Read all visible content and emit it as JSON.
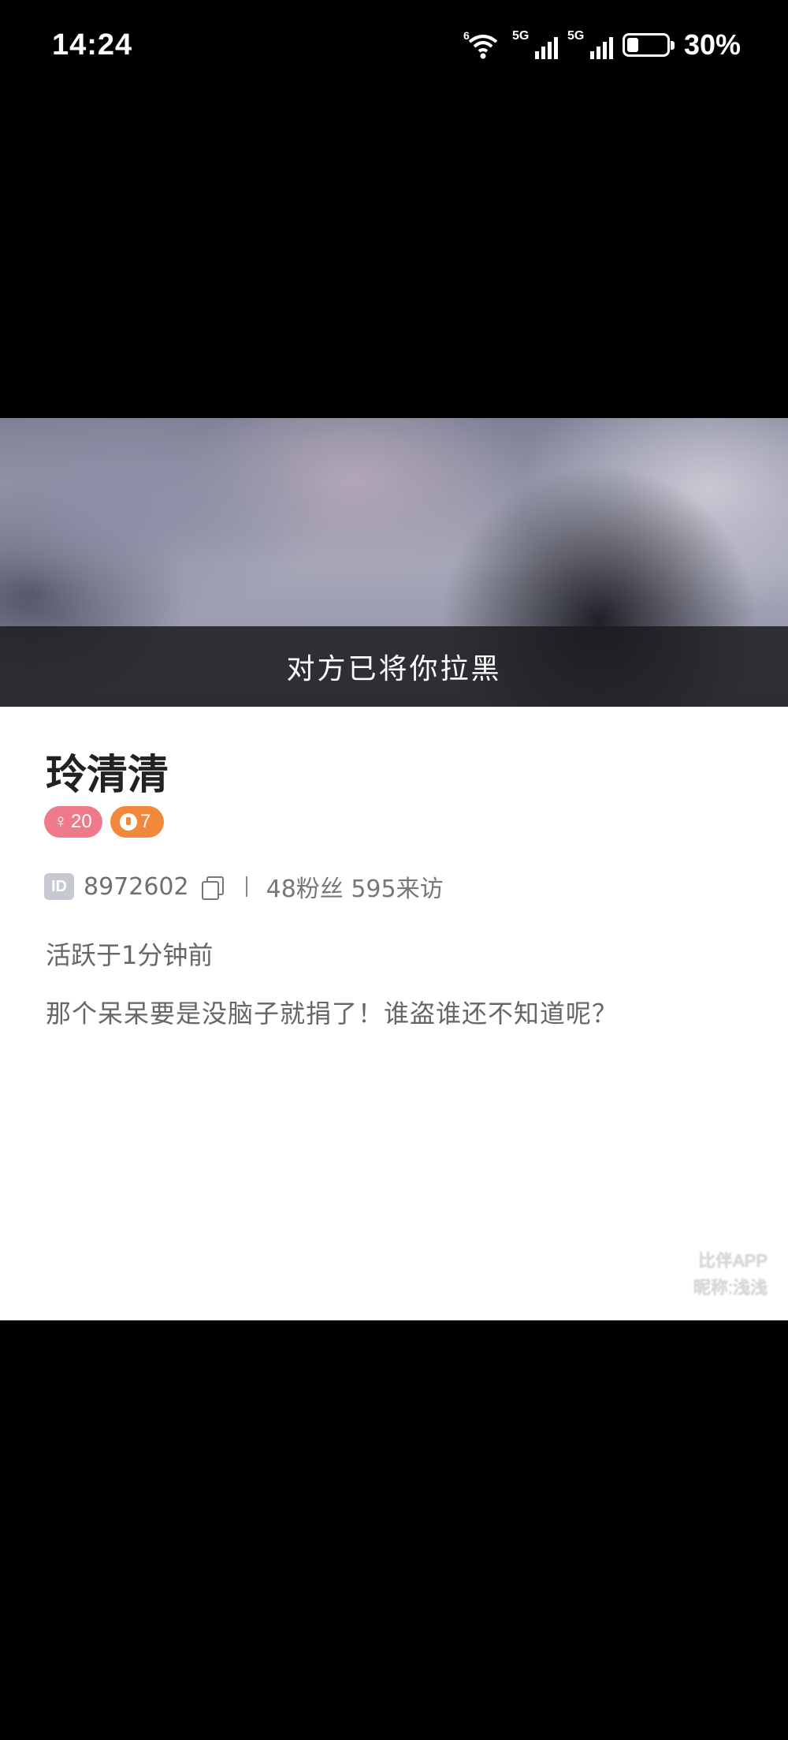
{
  "status_bar": {
    "time": "14:24",
    "wifi_tag": "6",
    "sim1_tag": "5G",
    "sim2_tag": "5G",
    "battery_percent": "30%",
    "battery_level": 0.3
  },
  "cover": {
    "blocked_message": "对方已将你拉黑"
  },
  "profile": {
    "name": "玲清清",
    "gender_badge": {
      "symbol": "♀",
      "value": "20",
      "color": "#ef7a8b"
    },
    "level_badge": {
      "value": "7",
      "color": "#f1883c"
    },
    "id_label": "ID",
    "id_value": "8972602",
    "stats": "48粉丝 595来访",
    "active_status": "活跃于1分钟前",
    "bio": "那个呆呆要是没脑子就捐了！谁盗谁还不知道呢？"
  },
  "watermark": {
    "line1": "比伴APP",
    "line2": "昵称:浅浅"
  }
}
